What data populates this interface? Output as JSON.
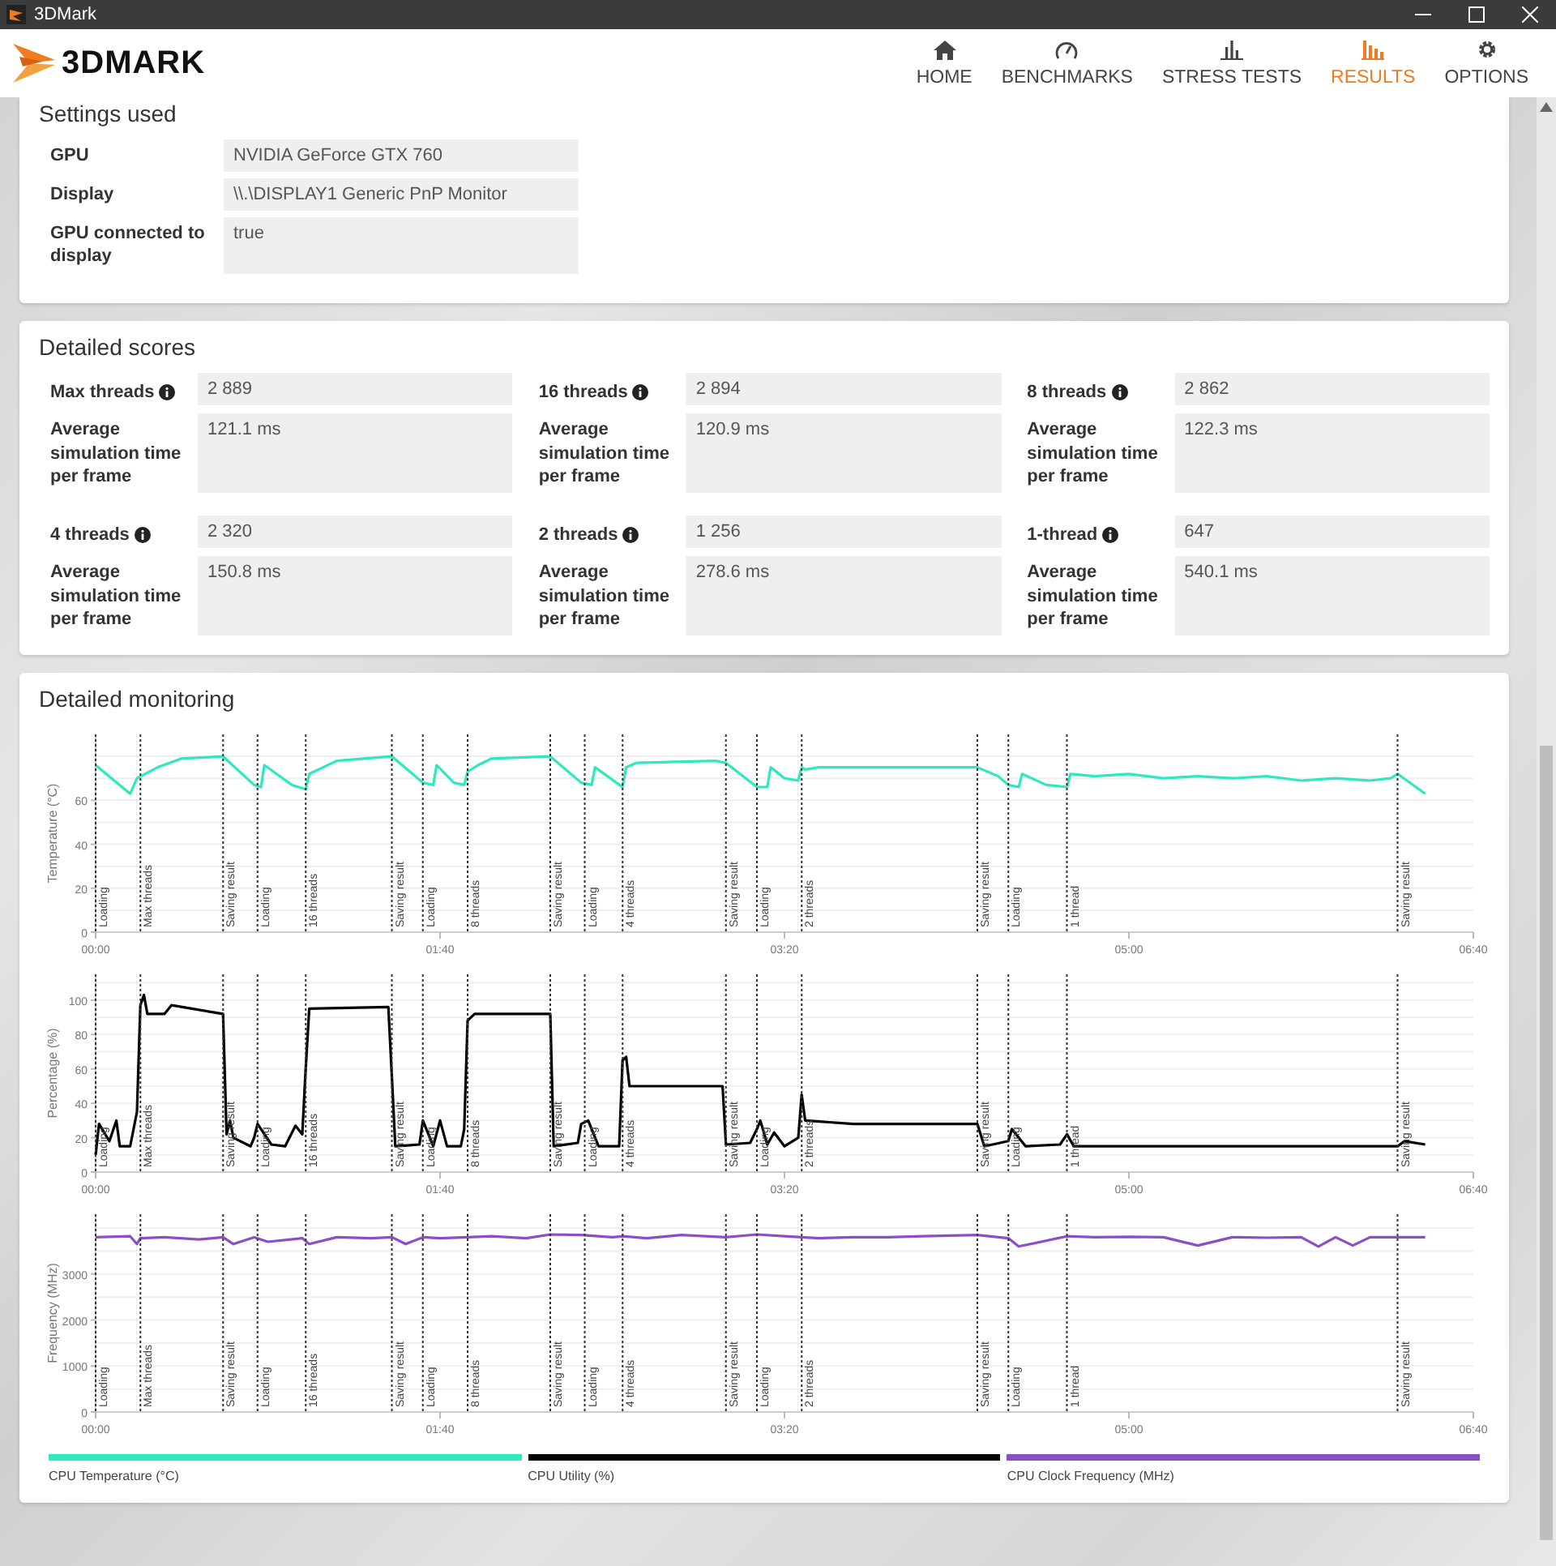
{
  "window": {
    "title": "3DMark"
  },
  "logo": {
    "text": "3DMARK"
  },
  "nav": [
    {
      "label": "HOME",
      "selected": false
    },
    {
      "label": "BENCHMARKS",
      "selected": false
    },
    {
      "label": "STRESS TESTS",
      "selected": false
    },
    {
      "label": "RESULTS",
      "selected": true
    },
    {
      "label": "OPTIONS",
      "selected": false
    }
  ],
  "settings_used": {
    "title": "Settings used",
    "rows": [
      {
        "label": "GPU",
        "value": "NVIDIA GeForce GTX 760"
      },
      {
        "label": "Display",
        "value": "\\\\.\\DISPLAY1 Generic PnP Monitor"
      },
      {
        "label": "GPU connected to display",
        "value": "true"
      }
    ]
  },
  "detailed_scores": {
    "title": "Detailed scores",
    "tests": [
      {
        "label": "Max threads",
        "score": "2 889",
        "metric_label": "Average simulation time per frame",
        "metric_value": "121.1 ms"
      },
      {
        "label": "16 threads",
        "score": "2 894",
        "metric_label": "Average simulation time per frame",
        "metric_value": "120.9 ms"
      },
      {
        "label": "8 threads",
        "score": "2 862",
        "metric_label": "Average simulation time per frame",
        "metric_value": "122.3 ms"
      },
      {
        "label": "4 threads",
        "score": "2 320",
        "metric_label": "Average simulation time per frame",
        "metric_value": "150.8 ms"
      },
      {
        "label": "2 threads",
        "score": "1 256",
        "metric_label": "Average simulation time per frame",
        "metric_value": "278.6 ms"
      },
      {
        "label": "1-thread",
        "score": "647",
        "metric_label": "Average simulation time per frame",
        "metric_value": "540.1 ms"
      }
    ]
  },
  "detailed_monitoring": {
    "title": "Detailed monitoring",
    "charts": [
      {
        "chart_data": {
          "type": "line",
          "ylabel": "Temperature (°C)",
          "grid": true,
          "xlim": [
            0,
            400
          ],
          "ylim": [
            0,
            90
          ],
          "yticks": [
            0,
            20,
            40,
            60
          ],
          "xticks": [
            {
              "value": 0,
              "label": "00:00"
            },
            {
              "value": 100,
              "label": "01:40"
            },
            {
              "value": 200,
              "label": "03:20"
            },
            {
              "value": 300,
              "label": "05:00"
            },
            {
              "value": 400,
              "label": "06:40"
            }
          ],
          "x": [
            0,
            10,
            12,
            18,
            25,
            37,
            46,
            48,
            49,
            57,
            61,
            62,
            70,
            86,
            95,
            98,
            99,
            104,
            107,
            108,
            111,
            115,
            132,
            141,
            144,
            145,
            153,
            154,
            157,
            180,
            183,
            192,
            195,
            196,
            200,
            204,
            205,
            206,
            210,
            256,
            262,
            265,
            268,
            269,
            276,
            282,
            283,
            290,
            300,
            310,
            320,
            330,
            340,
            350,
            360,
            370,
            376,
            378,
            386
          ],
          "series": [
            {
              "name": "CPU Temperature (°C)",
              "color": "#2ee8c0",
              "values": [
                76,
                63,
                70,
                75,
                79,
                80,
                67,
                66,
                76,
                67,
                65,
                72,
                78,
                80,
                68,
                67,
                76,
                68,
                67,
                73,
                76,
                79,
                80,
                68,
                67,
                75,
                66,
                75,
                77,
                78,
                77,
                66,
                66,
                75,
                70,
                69,
                75,
                74,
                75,
                75,
                71,
                67,
                66,
                72,
                67,
                66,
                72,
                71,
                72,
                70,
                71,
                70,
                71,
                69,
                70,
                69,
                70,
                72,
                63
              ]
            }
          ],
          "annotations": [
            "Loading",
            "Max threads",
            "Saving result",
            "Loading",
            "16 threads",
            "Saving result",
            "Loading",
            "8 threads",
            "Saving result",
            "Loading",
            "4 threads",
            "Saving result",
            "Loading",
            "2 threads",
            "Saving result",
            "Loading",
            "1 thread",
            "Saving result"
          ]
        }
      },
      {
        "chart_data": {
          "type": "line",
          "ylabel": "Percentage (%)",
          "grid": true,
          "xlim": [
            0,
            400
          ],
          "ylim": [
            0,
            115
          ],
          "yticks": [
            0,
            20,
            40,
            60,
            80,
            100
          ],
          "xticks": [
            {
              "value": 0,
              "label": "00:00"
            },
            {
              "value": 100,
              "label": "01:40"
            },
            {
              "value": 200,
              "label": "03:20"
            },
            {
              "value": 300,
              "label": "05:00"
            },
            {
              "value": 400,
              "label": "06:40"
            }
          ],
          "x": [
            0,
            1,
            4,
            6,
            7,
            10,
            12,
            13,
            14,
            15,
            20,
            22,
            37,
            38,
            39,
            40,
            45,
            46,
            47,
            51,
            55,
            58,
            60,
            61,
            62,
            85,
            86,
            87,
            94,
            95,
            98,
            100,
            102,
            106,
            107,
            108,
            110,
            132,
            133,
            140,
            141,
            143,
            146,
            152,
            153,
            154,
            155,
            182,
            183,
            190,
            192,
            193,
            195,
            197,
            200,
            204,
            205,
            206,
            220,
            256,
            258,
            265,
            266,
            270,
            280,
            282,
            284,
            378,
            380,
            386
          ],
          "series": [
            {
              "name": "CPU Utility (%)",
              "color": "#000000",
              "values": [
                10,
                28,
                18,
                30,
                15,
                15,
                35,
                97,
                103,
                92,
                92,
                97,
                92,
                22,
                30,
                20,
                15,
                20,
                28,
                16,
                15,
                27,
                22,
                60,
                95,
                96,
                55,
                15,
                16,
                30,
                15,
                30,
                15,
                15,
                25,
                88,
                92,
                92,
                15,
                17,
                28,
                30,
                15,
                15,
                65,
                67,
                50,
                50,
                16,
                17,
                25,
                30,
                16,
                23,
                15,
                20,
                45,
                30,
                28,
                28,
                15,
                18,
                25,
                15,
                16,
                22,
                15,
                15,
                18,
                16
              ]
            }
          ],
          "annotations": [
            "Loading",
            "Max threads",
            "Saving result",
            "Loading",
            "16 threads",
            "Saving result",
            "Loading",
            "8 threads",
            "Saving result",
            "Loading",
            "4 threads",
            "Saving result",
            "Loading",
            "2 threads",
            "Saving result",
            "Loading",
            "1 thread",
            "Saving result"
          ]
        }
      },
      {
        "chart_data": {
          "type": "line",
          "ylabel": "Frequency (MHz)",
          "grid": true,
          "xlim": [
            0,
            400
          ],
          "ylim": [
            0,
            4300
          ],
          "yticks": [
            0,
            1000,
            2000,
            3000
          ],
          "xticks": [
            {
              "value": 0,
              "label": "00:00"
            },
            {
              "value": 100,
              "label": "01:40"
            },
            {
              "value": 200,
              "label": "03:20"
            },
            {
              "value": 300,
              "label": "05:00"
            },
            {
              "value": 400,
              "label": "06:40"
            }
          ],
          "x": [
            0,
            10,
            12,
            13,
            20,
            30,
            37,
            40,
            46,
            50,
            60,
            61,
            62,
            70,
            80,
            86,
            90,
            95,
            100,
            108,
            115,
            125,
            132,
            141,
            150,
            153,
            160,
            170,
            183,
            192,
            200,
            205,
            210,
            220,
            230,
            240,
            256,
            265,
            268,
            282,
            290,
            300,
            310,
            320,
            330,
            340,
            350,
            355,
            360,
            365,
            370,
            378,
            386
          ],
          "series": [
            {
              "name": "CPU Clock Frequency (MHz)",
              "color": "#8a4fc8",
              "values": [
                3800,
                3820,
                3650,
                3780,
                3800,
                3750,
                3800,
                3650,
                3800,
                3700,
                3780,
                3720,
                3650,
                3800,
                3780,
                3800,
                3650,
                3800,
                3780,
                3800,
                3820,
                3780,
                3860,
                3850,
                3800,
                3820,
                3780,
                3850,
                3800,
                3860,
                3820,
                3800,
                3780,
                3800,
                3800,
                3820,
                3850,
                3780,
                3600,
                3820,
                3800,
                3810,
                3800,
                3620,
                3800,
                3790,
                3800,
                3600,
                3800,
                3620,
                3800,
                3800,
                3800
              ]
            }
          ],
          "annotations": [
            "Loading",
            "Max threads",
            "Saving result",
            "Loading",
            "16 threads",
            "Saving result",
            "Loading",
            "8 threads",
            "Saving result",
            "Loading",
            "4 threads",
            "Saving result",
            "Loading",
            "2 threads",
            "Saving result",
            "Loading",
            "1 thread",
            "Saving result"
          ]
        }
      }
    ]
  }
}
